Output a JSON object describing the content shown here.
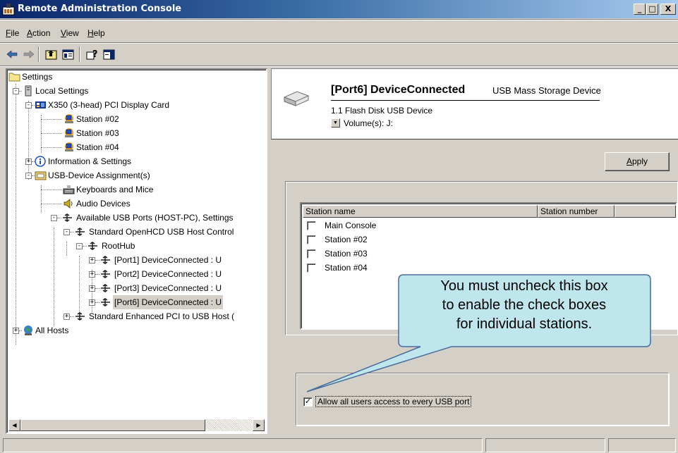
{
  "window": {
    "title": "Remote Administration Console",
    "caption_buttons": [
      "_",
      "□",
      "X"
    ]
  },
  "menu": [
    {
      "accel": "F",
      "rest": "ile"
    },
    {
      "accel": "A",
      "rest": "ction"
    },
    {
      "accel": "V",
      "rest": "iew"
    },
    {
      "accel": "H",
      "rest": "elp"
    }
  ],
  "toolbar": {
    "icons": [
      "back-arrow-icon",
      "forward-arrow-icon",
      "up-folder-icon",
      "show-hide-tree-icon",
      "help-icon",
      "action-pane-icon"
    ]
  },
  "tree": {
    "items": [
      {
        "label": "Settings"
      },
      {
        "label": "Local Settings"
      },
      {
        "label": "X350 (3-head)  PCI Display Card"
      },
      {
        "label": "Station #02"
      },
      {
        "label": "Station #03"
      },
      {
        "label": "Station #04"
      },
      {
        "label": "Information & Settings"
      },
      {
        "label": "USB-Device Assignment(s)"
      },
      {
        "label": "Keyboards and Mice"
      },
      {
        "label": "Audio Devices"
      },
      {
        "label": "Available USB Ports (HOST-PC), Settings"
      },
      {
        "label": "Standard OpenHCD USB Host Control"
      },
      {
        "label": "RootHub"
      },
      {
        "label": "[Port1] DeviceConnected :  U"
      },
      {
        "label": "[Port2] DeviceConnected :  U"
      },
      {
        "label": "[Port3] DeviceConnected :  U"
      },
      {
        "label": "[Port6] DeviceConnected :  U"
      },
      {
        "label": "Standard Enhanced PCI to USB Host ("
      },
      {
        "label": "All Hosts"
      }
    ],
    "expanders": [
      "-",
      "-",
      "-",
      "+",
      "-",
      "-",
      "-",
      "-",
      "+",
      "+",
      "+",
      "+",
      "+",
      "+"
    ]
  },
  "device": {
    "title": "[Port6] DeviceConnected",
    "type": "USB Mass Storage Device",
    "name": "1.1 Flash Disk USB Device",
    "volumes": "Volume(s):  J:"
  },
  "apply": {
    "accel": "A",
    "rest": "pply"
  },
  "stations": {
    "columns": [
      "Station name",
      "Station number"
    ],
    "rows": [
      {
        "name": "Main Console",
        "checked": false
      },
      {
        "name": "Station #02",
        "checked": false
      },
      {
        "name": "Station #03",
        "checked": false
      },
      {
        "name": "Station #04",
        "checked": false
      }
    ]
  },
  "allow_all": {
    "label": "Allow all users access to every USB port",
    "checked": true,
    "mark": "✓"
  },
  "callout": {
    "lines": [
      "You must uncheck this box",
      "to enable the check boxes",
      "for individual stations."
    ],
    "fill": "#bfe6ec",
    "stroke": "#4a6c9b"
  }
}
